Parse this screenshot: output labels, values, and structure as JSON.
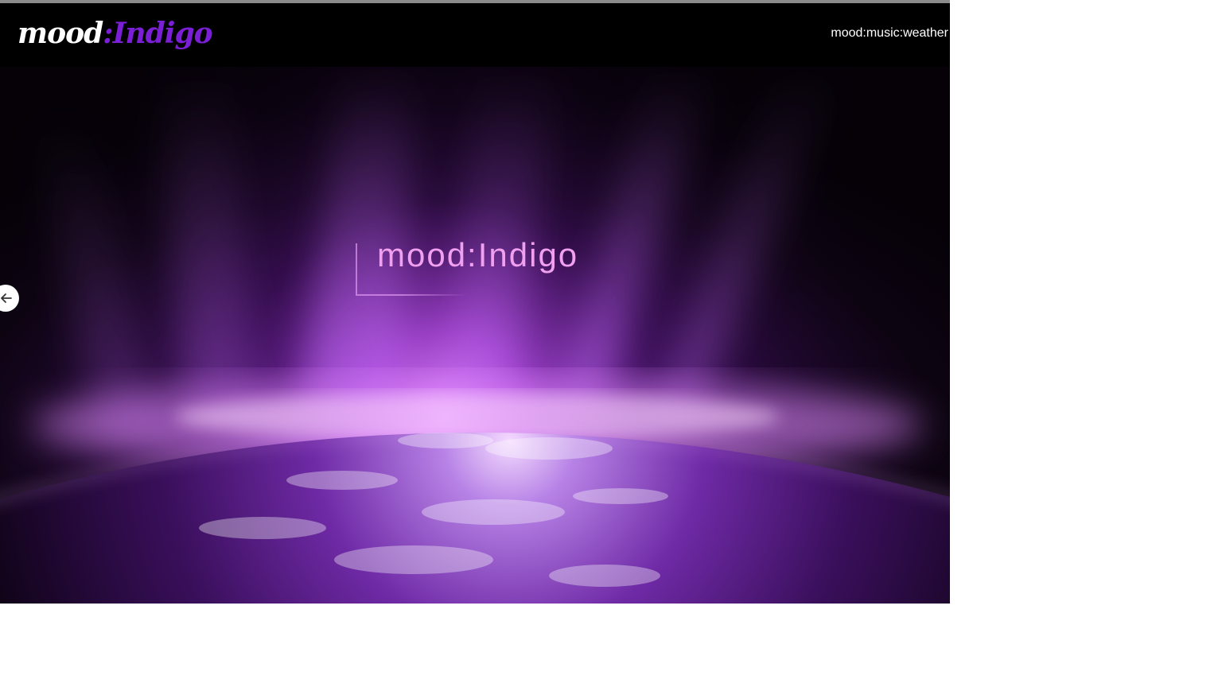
{
  "navbar": {
    "logo": {
      "first": "mood",
      "colon": ":",
      "second": "Indigo"
    },
    "link": "mood:music:weather"
  },
  "hero": {
    "headline": "mood:Indigo",
    "prev_icon": "arrow-left-icon"
  },
  "colors": {
    "accent": "#7a1fd6",
    "headline": "#f1a0f0",
    "background": "#000000"
  }
}
